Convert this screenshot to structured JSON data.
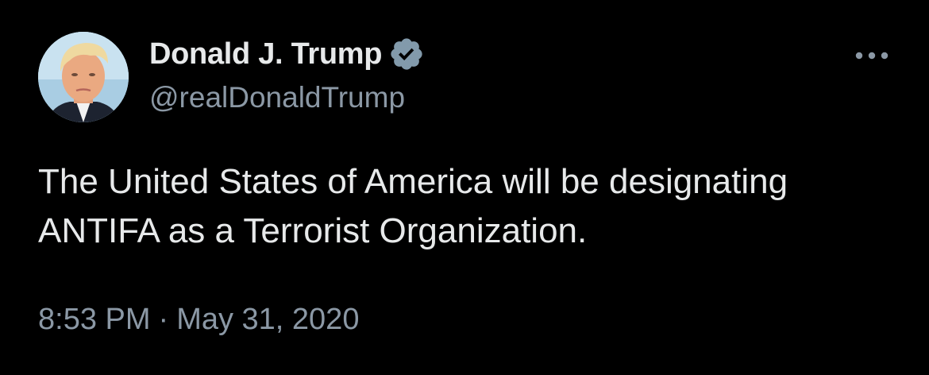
{
  "author": {
    "display_name": "Donald J. Trump",
    "handle": "@realDonaldTrump",
    "verified": true
  },
  "tweet": {
    "text": "The United States of America will be designating ANTIFA as a Terrorist Organization.",
    "time": "8:53 PM",
    "separator": "·",
    "date": "May 31, 2020"
  },
  "icons": {
    "verified": "verified-badge-icon",
    "more": "more-horizontal-icon",
    "avatar": "profile-avatar"
  },
  "colors": {
    "background": "#000000",
    "primary_text": "#e7e9ea",
    "secondary_text": "#8b98a5",
    "verified_badge": "#829aab"
  }
}
